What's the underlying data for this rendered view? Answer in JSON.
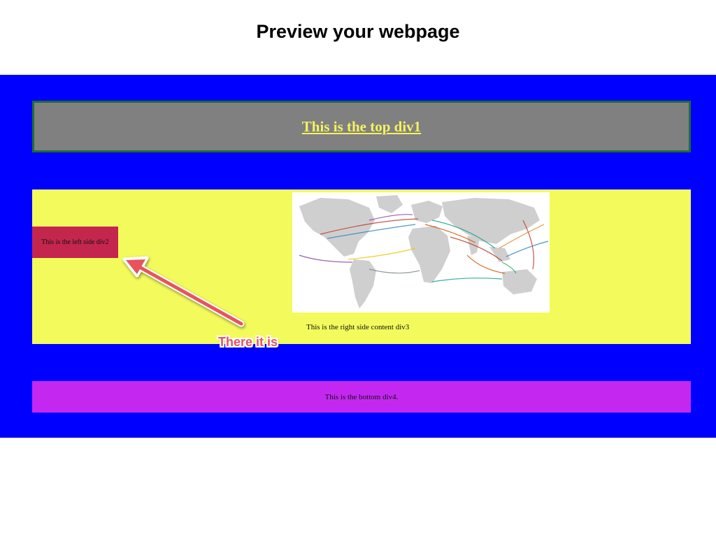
{
  "slide": {
    "title": "Preview your webpage"
  },
  "webpage": {
    "top_div_text": "This is the top div1",
    "left_div_text": "This is the left side div2",
    "right_div_text": "This is the right side content div3",
    "bottom_div_text": "This is the bottom div4.",
    "map_image": "world-map-image"
  },
  "annotation": {
    "callout_text": "There it is",
    "arrow_icon": "arrow-icon"
  },
  "colors": {
    "page_background": "#0000fe",
    "top_div_background": "#808080",
    "top_div_border": "#1f6e2e",
    "top_div_text": "#f4f260",
    "middle_div_background": "#f3fb5c",
    "left_div_background": "#c4264e",
    "bottom_div_background": "#c428f0",
    "callout_red": "#e8525d"
  }
}
